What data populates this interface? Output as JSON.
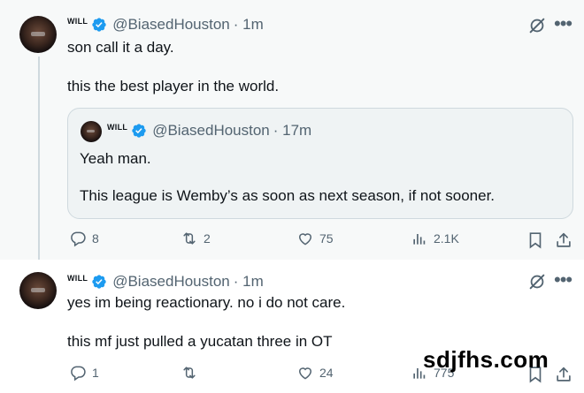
{
  "tweets": [
    {
      "author": {
        "name": "WILL",
        "handle": "@BiasedHouston",
        "time": "· 1m"
      },
      "lines": [
        "son call it a day.",
        "this the best player in the world."
      ],
      "quote": {
        "author": {
          "name": "WILL",
          "handle": "@BiasedHouston",
          "time": "· 17m"
        },
        "lines": [
          "Yeah man.",
          "This league is Wemby’s as soon as next season, if not sooner."
        ]
      },
      "stats": {
        "replies": "8",
        "reposts": "2",
        "likes": "75",
        "views": "2.1K"
      }
    },
    {
      "author": {
        "name": "WILL",
        "handle": "@BiasedHouston",
        "time": "· 1m"
      },
      "lines": [
        "yes im being reactionary. no i do not care.",
        "this mf just pulled a yucatan three in OT"
      ],
      "stats": {
        "replies": "1",
        "reposts": "",
        "likes": "24",
        "views": "775"
      }
    }
  ],
  "watermark": "sdjfhs.com",
  "colors": {
    "verified": "#1d9bf0",
    "muted": "#536471",
    "text": "#0f1419",
    "border": "#cfd9de"
  },
  "icons": [
    "verified-badge-icon",
    "grok-icon",
    "more-icon",
    "reply-icon",
    "repost-icon",
    "like-icon",
    "views-icon",
    "bookmark-icon",
    "share-icon"
  ]
}
